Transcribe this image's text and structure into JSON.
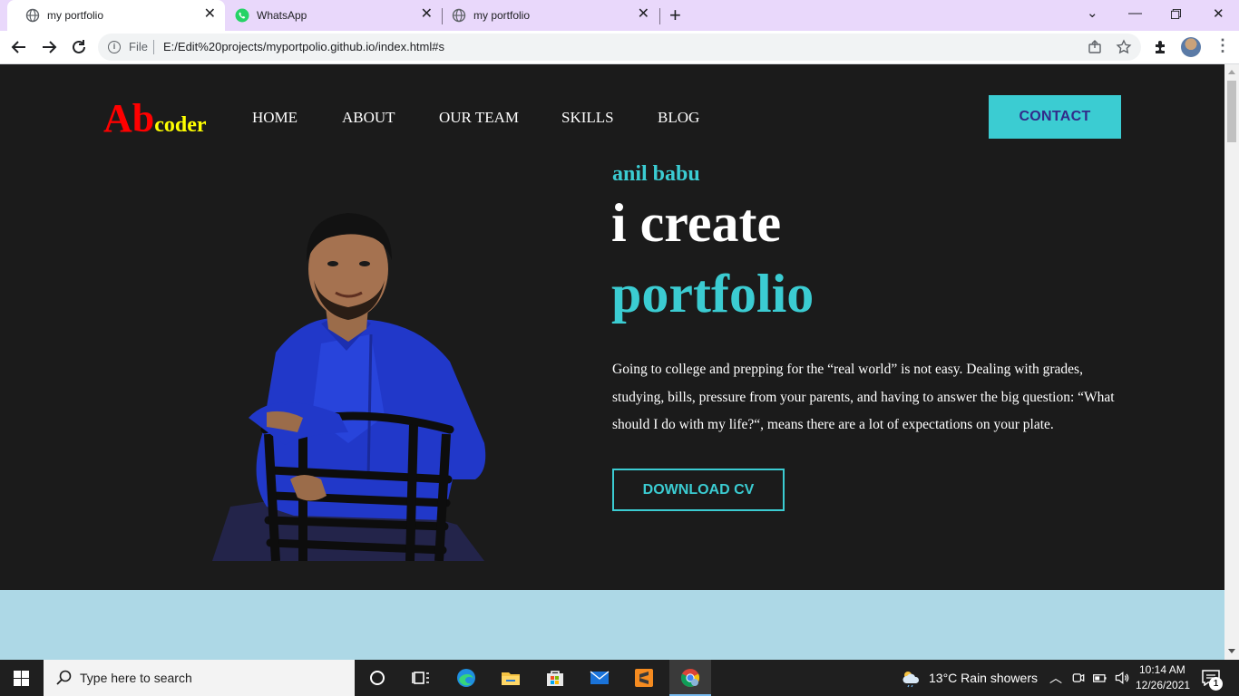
{
  "browser": {
    "tabs": [
      {
        "title": "my portfolio",
        "icon": "globe-icon"
      },
      {
        "title": "WhatsApp",
        "icon": "whatsapp-icon"
      },
      {
        "title": "my portfolio",
        "icon": "globe-icon"
      }
    ],
    "address": {
      "scheme_label": "File",
      "url": "E:/Edit%20projects/myportpolio.github.io/index.html#s"
    }
  },
  "site": {
    "logo": {
      "big": "Ab",
      "small": "coder"
    },
    "nav": [
      "HOME",
      "ABOUT",
      "OUR TEAM",
      "SKILLS",
      "BLOG"
    ],
    "contact_label": "CONTACT",
    "hero": {
      "name": "anil babu",
      "line1": "i create",
      "line2": "portfolio",
      "text": "Going to college and prepping for the “real world” is not easy. Dealing with grades, studying, bills, pressure from your parents, and having to answer the big question: “What should I do with my life?“, means there are a lot of expectations on your plate.",
      "cta_label": "DOWNLOAD CV"
    },
    "colors": {
      "accent": "#3bccd2",
      "background": "#1b1b1b",
      "logo_primary": "#ff0000",
      "logo_secondary": "#ffff00",
      "next_section": "#add8e6"
    }
  },
  "taskbar": {
    "search_placeholder": "Type here to search",
    "weather": "13°C  Rain showers",
    "time": "10:14 AM",
    "date": "12/26/2021",
    "notification_count": "1"
  }
}
